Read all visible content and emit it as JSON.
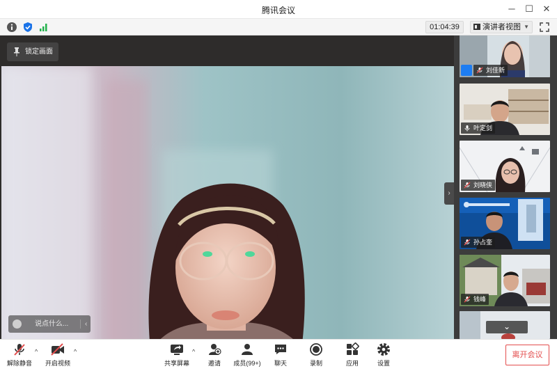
{
  "window": {
    "title": "腾讯会议",
    "minimize": "─",
    "maximize": "☐",
    "close": "✕"
  },
  "status_bar": {
    "timer": "01:04:39",
    "view_mode": "演讲者视图"
  },
  "main_video": {
    "lock_label": "锁定画面",
    "chat_placeholder": "说点什么...",
    "chat_collapse": "‹"
  },
  "sidebar": {
    "toggle": "›",
    "participants": [
      {
        "name": "刘佳新",
        "mic": "muted",
        "is_self": true
      },
      {
        "name": "叶定剑",
        "mic": "on"
      },
      {
        "name": "刘晓侠",
        "mic": "muted"
      },
      {
        "name": "孙占奎",
        "mic": "muted"
      },
      {
        "name": "钱峰",
        "mic": "muted"
      }
    ],
    "scroll_down": "⌄"
  },
  "toolbar": {
    "mute": "解除静音",
    "video": "开启视频",
    "share": "共享屏幕",
    "invite": "邀请",
    "members": "成员(99+)",
    "chat": "聊天",
    "record": "录制",
    "apps": "应用",
    "settings": "设置",
    "leave": "离开会议",
    "caret": "^"
  },
  "colors": {
    "accent_blue": "#1d7df2",
    "leave_red": "#e34d4d",
    "signal_green": "#22b14c",
    "shield_blue": "#1a73e8"
  }
}
